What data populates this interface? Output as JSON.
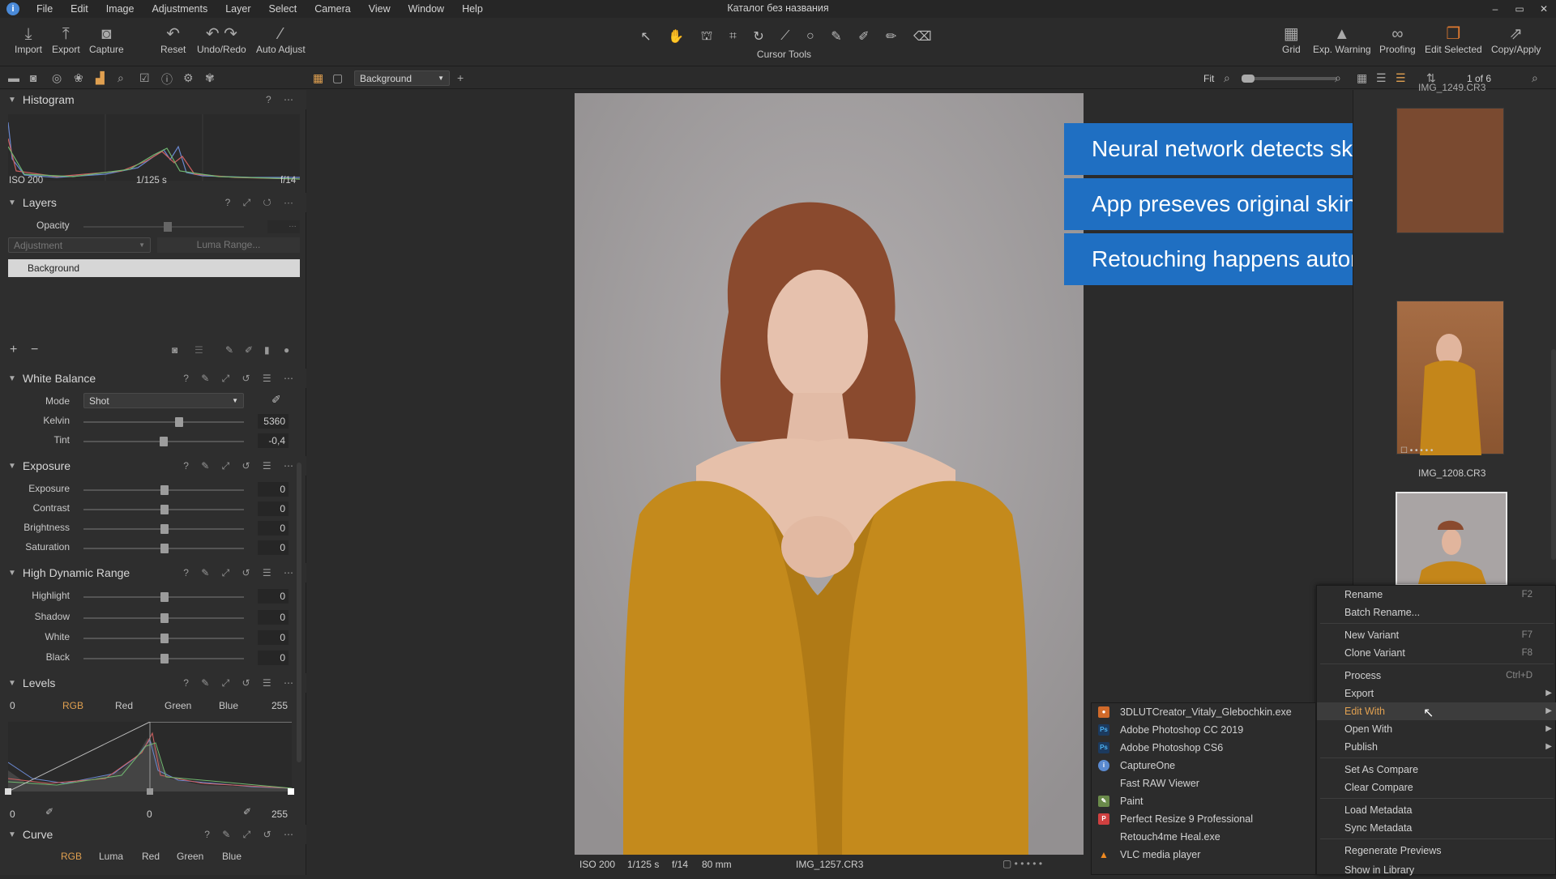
{
  "app": {
    "window_title": "Каталог без названия",
    "logo": "i"
  },
  "menu": [
    "File",
    "Edit",
    "Image",
    "Adjustments",
    "Layer",
    "Select",
    "Camera",
    "View",
    "Window",
    "Help"
  ],
  "toolbar": {
    "import": "Import",
    "export": "Export",
    "capture": "Capture",
    "reset": "Reset",
    "undo_redo": "Undo/Redo",
    "auto_adjust": "Auto Adjust",
    "cursor_tools": "Cursor Tools",
    "grid": "Grid",
    "exp_warning": "Exp. Warning",
    "proofing": "Proofing",
    "edit_selected": "Edit Selected",
    "copy_apply": "Copy/Apply"
  },
  "subbar": {
    "variant_select": "Background",
    "fit": "Fit",
    "counter": "1 of 6"
  },
  "histogram": {
    "title": "Histogram",
    "iso": "ISO 200",
    "shutter": "1/125 s",
    "aperture": "f/14"
  },
  "layers": {
    "title": "Layers",
    "opacity_label": "Opacity",
    "adjustment": "Adjustment",
    "luma_range": "Luma Range...",
    "background_layer": "Background"
  },
  "white_balance": {
    "title": "White Balance",
    "mode_label": "Mode",
    "mode_value": "Shot",
    "kelvin_label": "Kelvin",
    "kelvin_value": "5360",
    "tint_label": "Tint",
    "tint_value": "-0,4"
  },
  "exposure": {
    "title": "Exposure",
    "rows": [
      {
        "label": "Exposure",
        "value": "0"
      },
      {
        "label": "Contrast",
        "value": "0"
      },
      {
        "label": "Brightness",
        "value": "0"
      },
      {
        "label": "Saturation",
        "value": "0"
      }
    ]
  },
  "hdr": {
    "title": "High Dynamic Range",
    "rows": [
      {
        "label": "Highlight",
        "value": "0"
      },
      {
        "label": "Shadow",
        "value": "0"
      },
      {
        "label": "White",
        "value": "0"
      },
      {
        "label": "Black",
        "value": "0"
      }
    ]
  },
  "levels": {
    "title": "Levels",
    "low": "0",
    "high": "255",
    "tabs": [
      "RGB",
      "Red",
      "Green",
      "Blue"
    ],
    "out_low": "0",
    "mid": "0",
    "out_high": "255"
  },
  "curve": {
    "title": "Curve",
    "tabs": [
      "RGB",
      "Luma",
      "Red",
      "Green",
      "Blue"
    ]
  },
  "banners": [
    "Neural network detects skin problems",
    "App preseves original skin texture",
    "Retouching happens automatically"
  ],
  "photo_info": {
    "iso": "ISO 200",
    "shutter": "1/125 s",
    "aperture": "f/14",
    "focal": "80 mm",
    "filename": "IMG_1257.CR3"
  },
  "browser": {
    "thumb2_name": "IMG_1208.CR3",
    "thumb1_name": "IMG_1249.CR3"
  },
  "context_menu": [
    {
      "label": "Rename",
      "shortcut": "F2"
    },
    {
      "label": "Batch Rename...",
      "shortcut": ""
    },
    {
      "label": "New Variant",
      "shortcut": "F7"
    },
    {
      "label": "Clone Variant",
      "shortcut": "F8"
    },
    {
      "label": "Process",
      "shortcut": "Ctrl+D"
    },
    {
      "label": "Export",
      "shortcut": ""
    },
    {
      "label": "Edit With",
      "shortcut": ""
    },
    {
      "label": "Open With",
      "shortcut": ""
    },
    {
      "label": "Publish",
      "shortcut": ""
    },
    {
      "label": "Set As Compare",
      "shortcut": ""
    },
    {
      "label": "Clear Compare",
      "shortcut": ""
    },
    {
      "label": "Load Metadata",
      "shortcut": ""
    },
    {
      "label": "Sync Metadata",
      "shortcut": ""
    },
    {
      "label": "Regenerate Previews",
      "shortcut": ""
    },
    {
      "label": "Show in Library",
      "shortcut": ""
    }
  ],
  "edit_with_submenu": [
    {
      "label": "3DLUTCreator_Vitaly_Glebochkin.exe",
      "icon": "3dlut-icon"
    },
    {
      "label": "Adobe Photoshop CC 2019",
      "icon": "photoshop-icon"
    },
    {
      "label": "Adobe Photoshop CS6",
      "icon": "photoshop-icon"
    },
    {
      "label": "CaptureOne",
      "icon": "captureone-icon"
    },
    {
      "label": "Fast RAW Viewer",
      "icon": "none"
    },
    {
      "label": "Paint",
      "icon": "paint-icon"
    },
    {
      "label": "Perfect Resize 9 Professional",
      "icon": "perfect-resize-icon"
    },
    {
      "label": "Retouch4me Heal.exe",
      "icon": "none"
    },
    {
      "label": "VLC media player",
      "icon": "vlc-icon"
    }
  ],
  "colors": {
    "banner_blue": "#1f6fc2",
    "accent_orange": "#e0a050",
    "coat": "#c8901e"
  }
}
